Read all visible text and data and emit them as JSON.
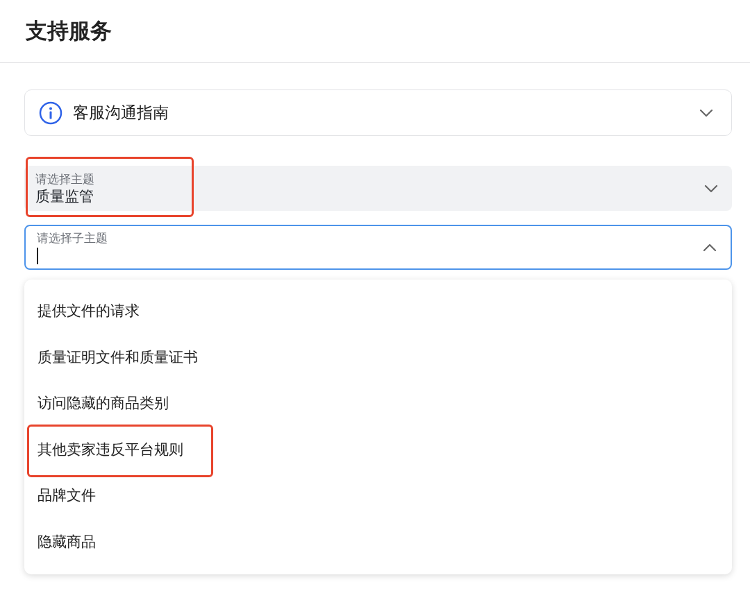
{
  "header": {
    "title": "支持服务"
  },
  "guide": {
    "label": "客服沟通指南",
    "expanded": false
  },
  "topic": {
    "label": "请选择主题",
    "value": "质量监管",
    "highlighted": true
  },
  "subtopic": {
    "label": "请选择子主题",
    "focused": true,
    "expanded": true
  },
  "options": [
    {
      "label": "提供文件的请求",
      "highlighted": false
    },
    {
      "label": "质量证明文件和质量证书",
      "highlighted": false
    },
    {
      "label": "访问隐藏的商品类别",
      "highlighted": false
    },
    {
      "label": "其他卖家违反平台规则",
      "highlighted": true
    },
    {
      "label": "品牌文件",
      "highlighted": false
    },
    {
      "label": "隐藏商品",
      "highlighted": false
    }
  ]
}
